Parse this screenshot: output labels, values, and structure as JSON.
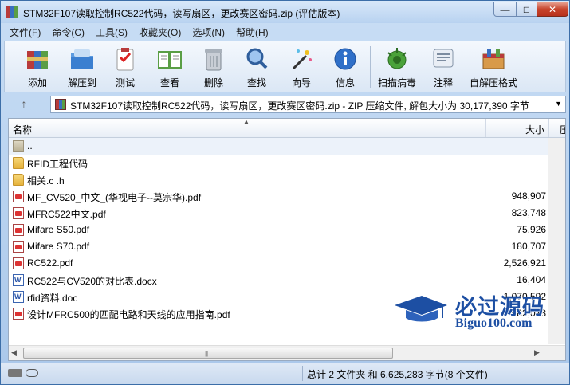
{
  "window": {
    "title": "STM32F107读取控制RC522代码，读写扇区，更改赛区密码.zip (评估版本)",
    "min_label": "—",
    "max_label": "□",
    "close_label": "✕"
  },
  "menu": [
    "文件(F)",
    "命令(C)",
    "工具(S)",
    "收藏夹(O)",
    "选项(N)",
    "帮助(H)"
  ],
  "toolbar": [
    {
      "label": "添加",
      "icon": "add-archive-icon"
    },
    {
      "label": "解压到",
      "icon": "extract-folder-icon"
    },
    {
      "label": "测试",
      "icon": "test-clipboard-icon"
    },
    {
      "label": "查看",
      "icon": "view-book-icon"
    },
    {
      "label": "删除",
      "icon": "trash-icon"
    },
    {
      "label": "查找",
      "icon": "magnifier-icon"
    },
    {
      "label": "向导",
      "icon": "wizard-wand-icon"
    },
    {
      "label": "信息",
      "icon": "info-icon"
    },
    {
      "label": "扫描病毒",
      "icon": "virus-scan-icon"
    },
    {
      "label": "注释",
      "icon": "comment-icon"
    },
    {
      "label": "自解压格式",
      "icon": "sfx-box-icon"
    }
  ],
  "address": {
    "up_label": "↑",
    "path": "STM32F107读取控制RC522代码，读写扇区，更改赛区密码.zip - ZIP 压缩文件, 解包大小为 30,177,390 字节",
    "dropdown": "▼"
  },
  "columns": {
    "name": "名称",
    "size": "大小",
    "type": "压"
  },
  "files": [
    {
      "name": "..",
      "size": "",
      "kind": "folder-up"
    },
    {
      "name": "RFID工程代码",
      "size": "",
      "kind": "folder"
    },
    {
      "name": "相关.c .h",
      "size": "",
      "kind": "folder"
    },
    {
      "name": "MF_CV520_中文_(华视电子--莫宗华).pdf",
      "size": "948,907",
      "kind": "pdf"
    },
    {
      "name": "MFRC522中文.pdf",
      "size": "823,748",
      "kind": "pdf"
    },
    {
      "name": "Mifare S50.pdf",
      "size": "75,926",
      "kind": "pdf"
    },
    {
      "name": "Mifare S70.pdf",
      "size": "180,707",
      "kind": "pdf"
    },
    {
      "name": "RC522.pdf",
      "size": "2,526,921",
      "kind": "pdf"
    },
    {
      "name": "RC522与CV520的对比表.docx",
      "size": "16,404",
      "kind": "docx"
    },
    {
      "name": "rfid资料.doc",
      "size": "1,070,592",
      "kind": "doc"
    },
    {
      "name": "设计MFRC500的匹配电路和天线的应用指南.pdf",
      "size": "982,078",
      "kind": "pdf"
    }
  ],
  "scroll": {
    "left": "◀",
    "right": "▶",
    "grip": "|||"
  },
  "status": {
    "text": "总计 2 文件夹 和 6,625,283 字节(8 个文件)"
  },
  "watermark": {
    "cn": "必过源码",
    "url": "Biguo100.com"
  }
}
